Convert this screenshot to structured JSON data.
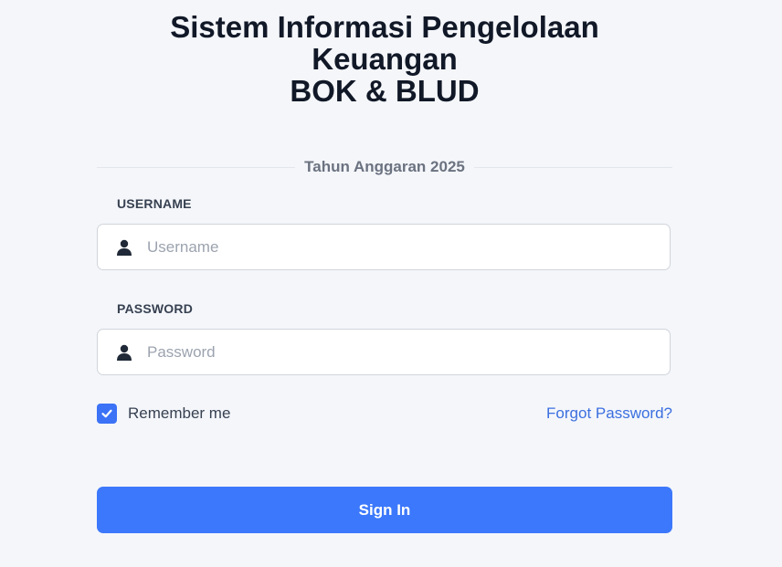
{
  "header": {
    "title_line1": "Sistem Informasi Pengelolaan",
    "title_line2": "Keuangan",
    "title_line3": "BOK & BLUD"
  },
  "fiscal_year": {
    "label": "Tahun Anggaran 2025"
  },
  "form": {
    "username": {
      "label": "USERNAME",
      "placeholder": "Username",
      "icon": "user-icon"
    },
    "password": {
      "label": "PASSWORD",
      "placeholder": "Password",
      "icon": "user-icon"
    },
    "remember": {
      "label": "Remember me",
      "checked": true
    },
    "forgot_label": "Forgot Password?",
    "submit_label": "Sign In"
  },
  "colors": {
    "primary": "#3c78fb",
    "link": "#3b6fe0",
    "background": "#f4f6fa"
  }
}
